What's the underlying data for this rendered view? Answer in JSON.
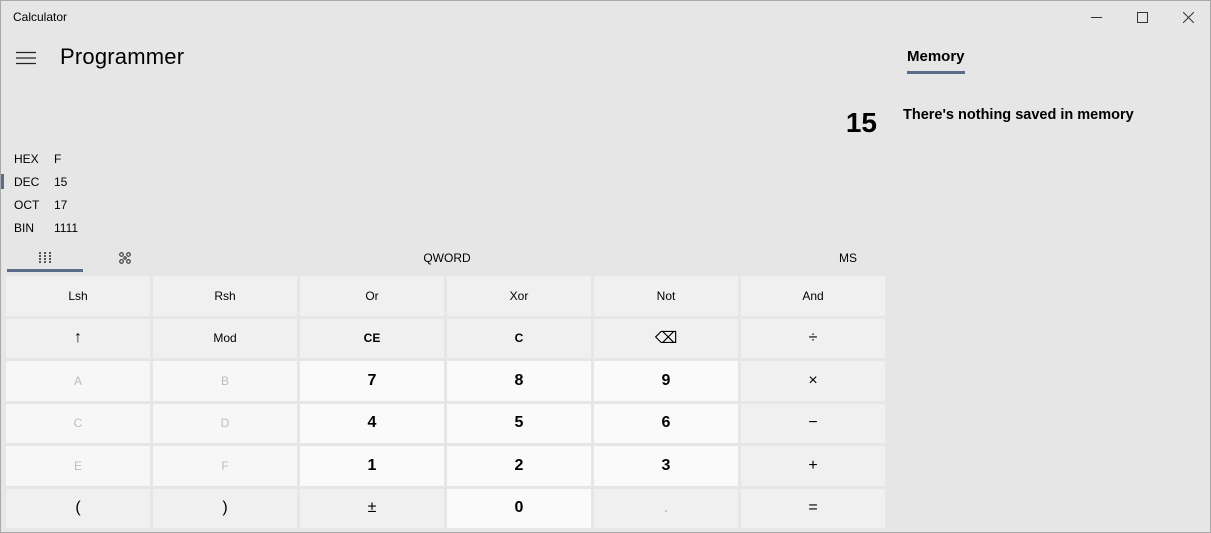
{
  "window": {
    "title": "Calculator",
    "minimize_icon": "minimize-icon",
    "maximize_icon": "maximize-icon",
    "close_icon": "close-icon"
  },
  "header": {
    "menu_icon": "hamburger-menu-icon",
    "mode": "Programmer"
  },
  "display": {
    "value": "15"
  },
  "radix": [
    {
      "name": "HEX",
      "value": "F"
    },
    {
      "name": "DEC",
      "value": "15"
    },
    {
      "name": "OCT",
      "value": "17"
    },
    {
      "name": "BIN",
      "value": "1111"
    }
  ],
  "toolbar": {
    "keypad_icon": "full-keypad-icon",
    "bit_toggle_icon": "bit-toggling-keypad-icon",
    "word_size": "QWORD",
    "ms_label": "MS"
  },
  "keys": {
    "row1": [
      "Lsh",
      "Rsh",
      "Or",
      "Xor",
      "Not",
      "And"
    ],
    "row2": [
      "↑",
      "Mod",
      "CE",
      "C",
      "⌫",
      "÷"
    ],
    "row3": [
      "A",
      "B",
      "7",
      "8",
      "9",
      "×"
    ],
    "row4": [
      "C",
      "D",
      "4",
      "5",
      "6",
      "−"
    ],
    "row5": [
      "E",
      "F",
      "1",
      "2",
      "3",
      "+"
    ],
    "row6": [
      "(",
      ")",
      "±",
      "0",
      ".",
      "="
    ]
  },
  "memory": {
    "tab_label": "Memory",
    "empty_message": "There's nothing saved in memory"
  },
  "colors": {
    "background": "#e6e6e6",
    "accent": "#5b6c8a",
    "key": "#f0f0f0",
    "number_key": "#fafafa"
  }
}
